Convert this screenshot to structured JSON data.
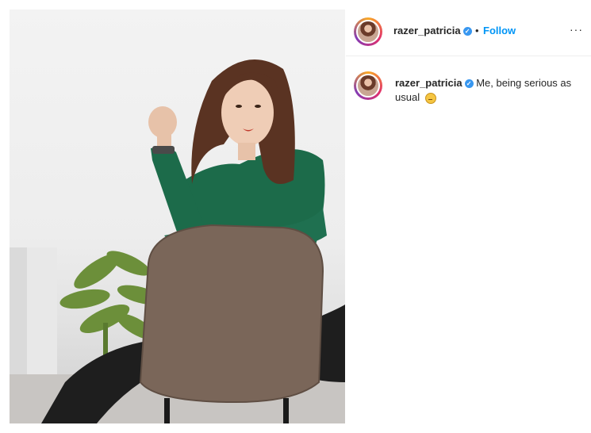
{
  "post": {
    "username": "razer_patricia",
    "verified_icon": "verified-badge-icon",
    "separator": "•",
    "follow_label": "Follow",
    "more_label": "···"
  },
  "caption": {
    "username": "razer_patricia",
    "text": "Me, being serious as usual",
    "emoji": "😐"
  },
  "colors": {
    "follow": "#0095f6",
    "verified": "#3897f0",
    "text": "#262626"
  }
}
